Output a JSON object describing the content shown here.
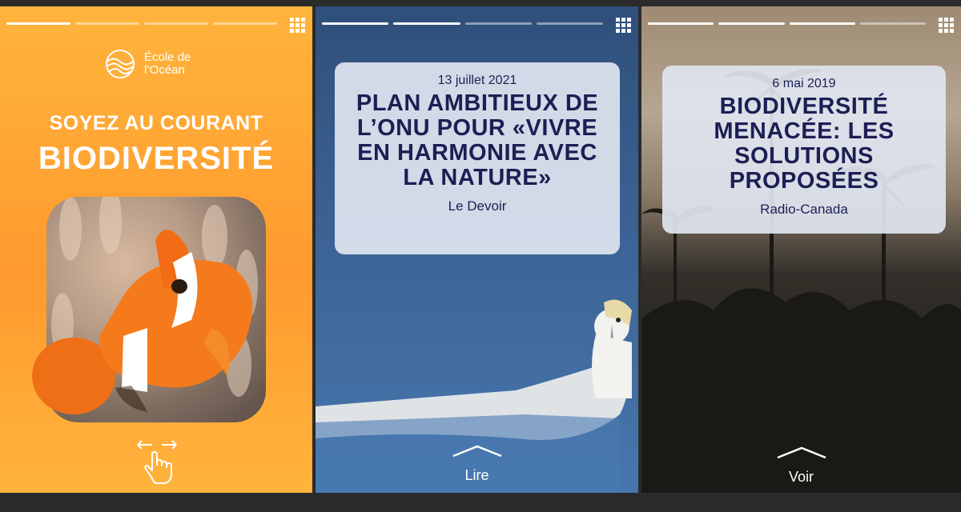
{
  "panel1": {
    "progress": [
      true,
      false,
      false,
      false
    ],
    "logo_text": "École de l’Océan",
    "headline_small": "SOYEZ AU COURANT",
    "headline_big": "BIODIVERSITÉ",
    "background_color": "#ff9f31"
  },
  "panel2": {
    "progress": [
      true,
      true,
      false,
      false
    ],
    "date": "13 juillet 2021",
    "title": "PLAN AMBITIEUX DE L’ONU POUR «VIVRE EN HARMONIE AVEC LA NATURE»",
    "source": "Le Devoir",
    "cta_label": "Lire"
  },
  "panel3": {
    "progress": [
      true,
      true,
      true,
      false
    ],
    "date": "6 mai 2019",
    "title": "BIODIVERSITÉ MENACÉE: LES SOLUTIONS PROPOSÉES",
    "source": "Radio-Canada",
    "cta_label": "Voir"
  },
  "icons": {
    "grid": "grid-icon",
    "swipe": "hand-swipe-icon",
    "chevron": "chevron-up-icon",
    "logo": "wave-sun-logo-icon"
  },
  "colors": {
    "card_text": "#1c1f54",
    "card_bg": "#e0e5f0"
  }
}
